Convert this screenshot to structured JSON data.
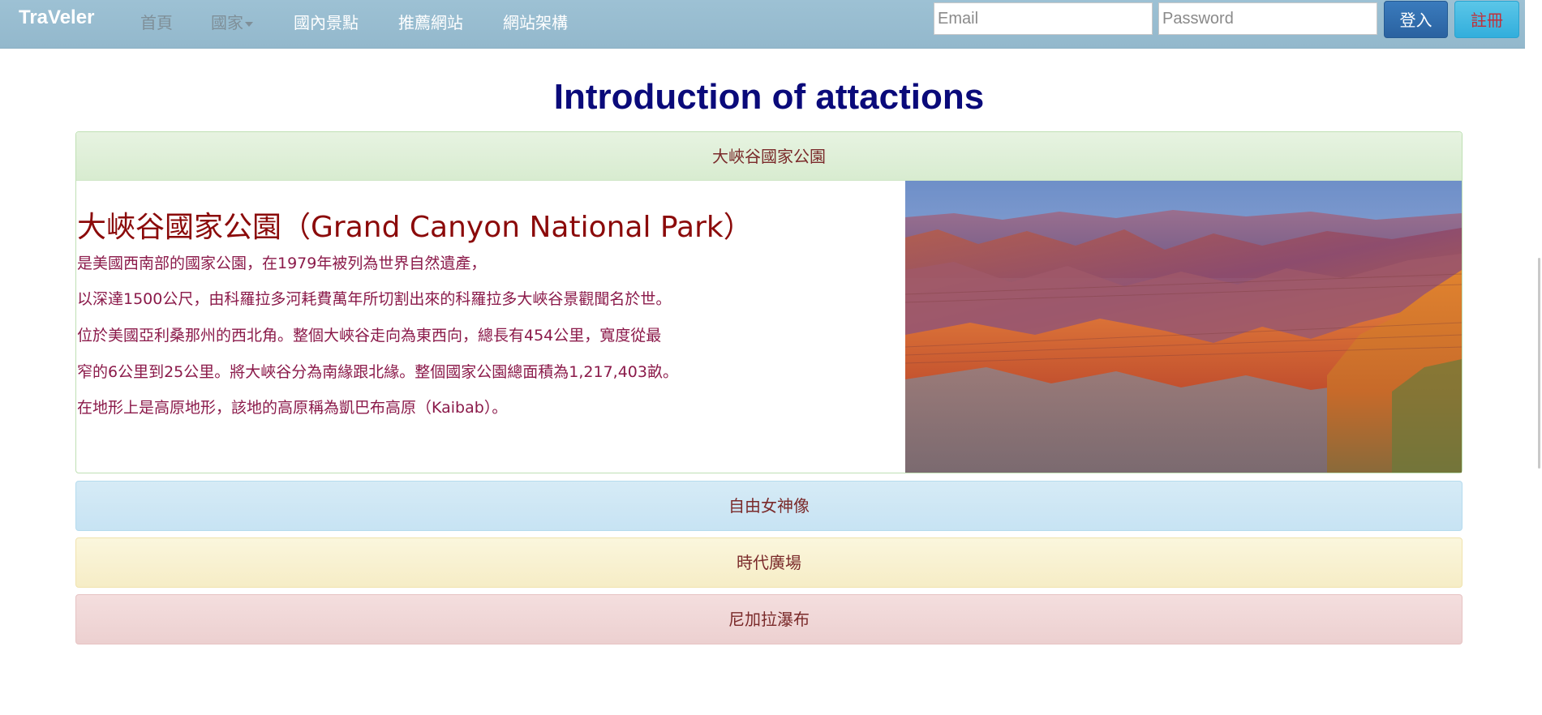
{
  "navbar": {
    "brand": "TraVeler",
    "items": [
      {
        "label": "首頁"
      },
      {
        "label": "國家"
      },
      {
        "label": "國內景點"
      },
      {
        "label": "推薦網站"
      },
      {
        "label": "網站架構"
      }
    ],
    "email_placeholder": "Email",
    "password_placeholder": "Password",
    "login_label": "登入",
    "register_label": "註冊"
  },
  "main": {
    "title": "Introduction of attactions",
    "panels": [
      {
        "heading": "大峽谷國家公園",
        "title": "大峽谷國家公園（Grand Canyon National Park）",
        "lines": [
          "是美國西南部的國家公園，在1979年被列為世界自然遺產，",
          "以深達1500公尺，由科羅拉多河耗費萬年所切割出來的科羅拉多大峽谷景觀聞名於世。",
          "位於美國亞利桑那州的西北角。整個大峽谷走向為東西向，總長有454公里，寬度從最",
          "窄的6公里到25公里。將大峽谷分為南緣跟北緣。整個國家公園總面積為1,217,403畝。",
          "在地形上是高原地形，該地的高原稱為凱巴布高原（Kaibab）。"
        ]
      },
      {
        "heading": "自由女神像"
      },
      {
        "heading": "時代廣場"
      },
      {
        "heading": "尼加拉瀑布"
      }
    ]
  },
  "colors": {
    "navbar": "#9dc1d4",
    "title": "#0a0a7a",
    "park_title": "#8b0a0a",
    "body_text": "#8b1a4a"
  }
}
